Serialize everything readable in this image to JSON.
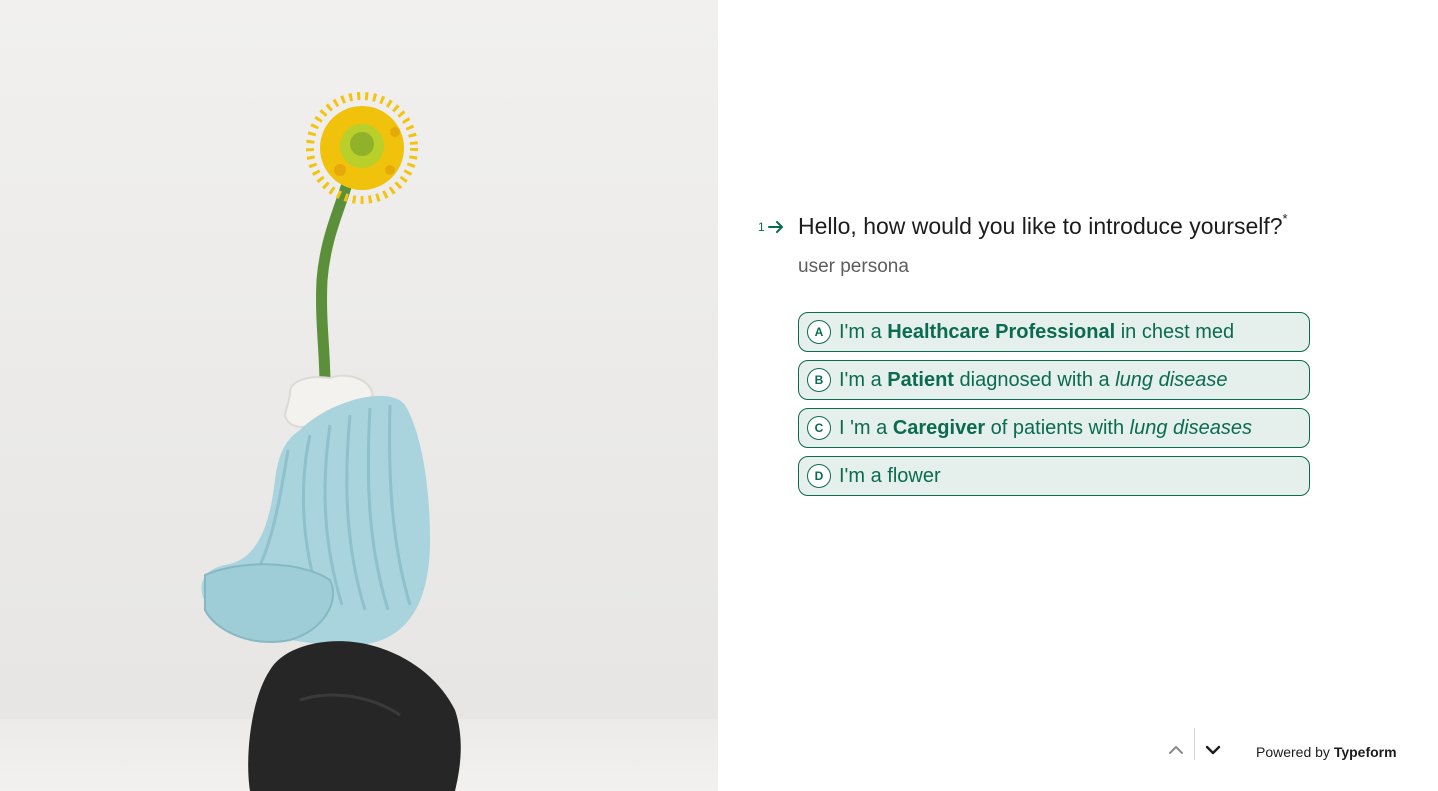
{
  "question": {
    "number": "1",
    "arrow_icon": "arrow-right-icon",
    "title": "Hello, how would you like to introduce yourself?",
    "required_mark": "*",
    "description": "user persona"
  },
  "choices": [
    {
      "key": "A",
      "pre": "I'm a ",
      "bold": "Healthcare Professional",
      "mid": " in chest med",
      "italic": ""
    },
    {
      "key": "B",
      "pre": "I'm a ",
      "bold": "Patient",
      "mid": " diagnosed with a ",
      "italic": "lung disease"
    },
    {
      "key": "C",
      "pre": "I 'm a ",
      "bold": "Caregiver",
      "mid": " of patients with ",
      "italic": "lung diseases"
    },
    {
      "key": "D",
      "pre": "I'm a flower",
      "bold": "",
      "mid": "",
      "italic": ""
    }
  ],
  "footer": {
    "powered_prefix": "Powered by ",
    "brand": "Typeform",
    "nav_up_icon": "chevron-up-icon",
    "nav_down_icon": "chevron-down-icon"
  },
  "colors": {
    "accent": "#0b6b50",
    "choice_bg": "#e5efec",
    "text": "#1c1c1c"
  }
}
